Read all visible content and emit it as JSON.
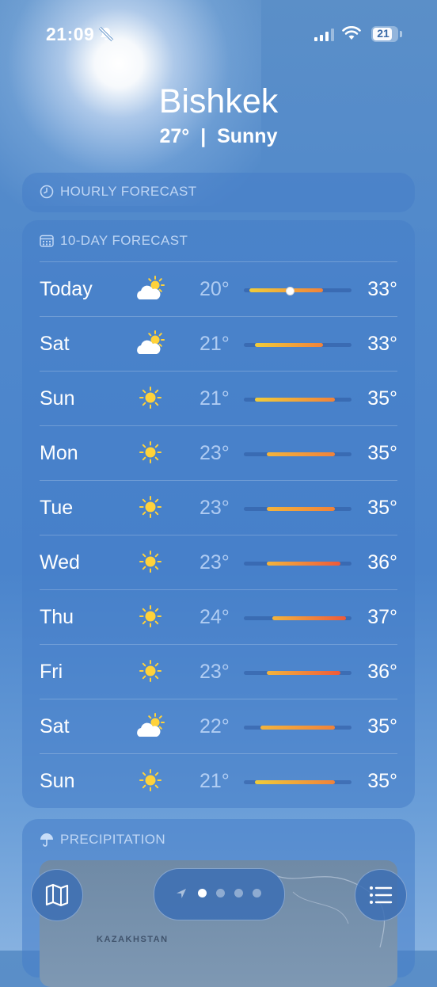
{
  "status": {
    "time": "21:09",
    "battery": "21"
  },
  "location": {
    "city": "Bishkek",
    "summary": "27°  |  Sunny"
  },
  "hourly": {
    "title": "HOURLY FORECAST"
  },
  "forecast": {
    "title": "10-DAY FORECAST",
    "days": [
      {
        "day": "Today",
        "icon": "partly-sunny-icon",
        "low": "20°",
        "high": "33°",
        "range": [
          20,
          33
        ],
        "current": 27
      },
      {
        "day": "Sat",
        "icon": "partly-sunny-icon",
        "low": "21°",
        "high": "33°",
        "range": [
          21,
          33
        ]
      },
      {
        "day": "Sun",
        "icon": "sun-icon",
        "low": "21°",
        "high": "35°",
        "range": [
          21,
          35
        ]
      },
      {
        "day": "Mon",
        "icon": "sun-icon",
        "low": "23°",
        "high": "35°",
        "range": [
          23,
          35
        ]
      },
      {
        "day": "Tue",
        "icon": "sun-icon",
        "low": "23°",
        "high": "35°",
        "range": [
          23,
          35
        ]
      },
      {
        "day": "Wed",
        "icon": "sun-icon",
        "low": "23°",
        "high": "36°",
        "range": [
          23,
          36
        ]
      },
      {
        "day": "Thu",
        "icon": "sun-icon",
        "low": "24°",
        "high": "37°",
        "range": [
          24,
          37
        ]
      },
      {
        "day": "Fri",
        "icon": "sun-icon",
        "low": "23°",
        "high": "36°",
        "range": [
          23,
          36
        ]
      },
      {
        "day": "Sat",
        "icon": "partly-sunny-icon",
        "low": "22°",
        "high": "35°",
        "range": [
          22,
          35
        ]
      },
      {
        "day": "Sun",
        "icon": "sun-icon",
        "low": "21°",
        "high": "35°",
        "range": [
          21,
          35
        ]
      }
    ],
    "scale": [
      19,
      38
    ]
  },
  "precipitation": {
    "title": "PRECIPITATION",
    "map_label": "KAZAKHSTAN"
  },
  "pager": {
    "pages": 5,
    "current_page": 2
  }
}
